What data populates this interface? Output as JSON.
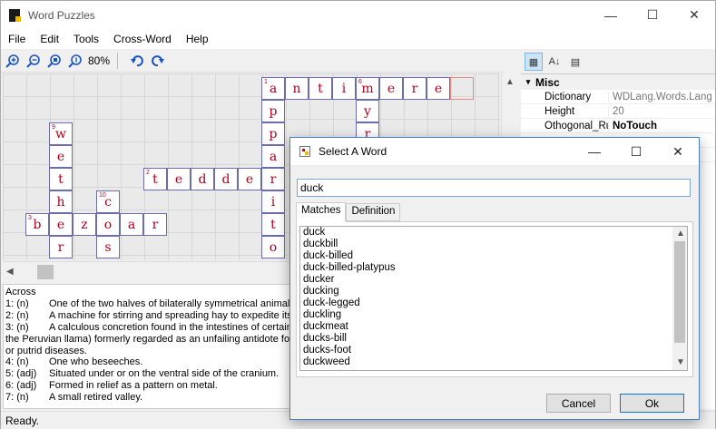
{
  "window": {
    "title": "Word Puzzles"
  },
  "menu": [
    "File",
    "Edit",
    "Tools",
    "Cross-Word",
    "Help"
  ],
  "toolbar": {
    "zoom": "80%"
  },
  "puzzle": {
    "cells": [
      {
        "row": 0,
        "col": 11,
        "letter": "a",
        "num": "1"
      },
      {
        "row": 0,
        "col": 12,
        "letter": "n"
      },
      {
        "row": 0,
        "col": 13,
        "letter": "t"
      },
      {
        "row": 0,
        "col": 14,
        "letter": "i"
      },
      {
        "row": 0,
        "col": 15,
        "letter": "m",
        "num": "6"
      },
      {
        "row": 0,
        "col": 16,
        "letter": "e"
      },
      {
        "row": 0,
        "col": 17,
        "letter": "r"
      },
      {
        "row": 0,
        "col": 18,
        "letter": "e"
      },
      {
        "row": 0,
        "col": 19,
        "letter": "",
        "empty": true
      },
      {
        "row": 1,
        "col": 11,
        "letter": "p"
      },
      {
        "row": 1,
        "col": 15,
        "letter": "y"
      },
      {
        "row": 2,
        "col": 2,
        "letter": "w",
        "num": "9"
      },
      {
        "row": 2,
        "col": 11,
        "letter": "p"
      },
      {
        "row": 2,
        "col": 15,
        "letter": "r"
      },
      {
        "row": 3,
        "col": 2,
        "letter": "e"
      },
      {
        "row": 3,
        "col": 11,
        "letter": "a"
      },
      {
        "row": 4,
        "col": 2,
        "letter": "t"
      },
      {
        "row": 4,
        "col": 6,
        "letter": "t",
        "num": "2"
      },
      {
        "row": 4,
        "col": 7,
        "letter": "e"
      },
      {
        "row": 4,
        "col": 8,
        "letter": "d"
      },
      {
        "row": 4,
        "col": 9,
        "letter": "d"
      },
      {
        "row": 4,
        "col": 10,
        "letter": "e"
      },
      {
        "row": 4,
        "col": 11,
        "letter": "r"
      },
      {
        "row": 5,
        "col": 2,
        "letter": "h"
      },
      {
        "row": 5,
        "col": 4,
        "letter": "c",
        "num": "10"
      },
      {
        "row": 5,
        "col": 11,
        "letter": "i"
      },
      {
        "row": 6,
        "col": 1,
        "letter": "b",
        "num": "3"
      },
      {
        "row": 6,
        "col": 2,
        "letter": "e"
      },
      {
        "row": 6,
        "col": 3,
        "letter": "z"
      },
      {
        "row": 6,
        "col": 4,
        "letter": "o"
      },
      {
        "row": 6,
        "col": 5,
        "letter": "a"
      },
      {
        "row": 6,
        "col": 6,
        "letter": "r"
      },
      {
        "row": 6,
        "col": 11,
        "letter": "t"
      },
      {
        "row": 7,
        "col": 2,
        "letter": "r"
      },
      {
        "row": 7,
        "col": 4,
        "letter": "s"
      },
      {
        "row": 7,
        "col": 11,
        "letter": "o"
      }
    ]
  },
  "clues": {
    "heading": "Across",
    "items": [
      {
        "no": "1: (n)",
        "text": "One of the two halves of bilaterally symmetrical animals."
      },
      {
        "no": "2: (n)",
        "text": "A machine for stirring and spreading hay to expedite its drying."
      },
      {
        "no": "3: (n)",
        "text": "A calculous concretion found in the intestines of certain ruminants (as"
      },
      {
        "no": "",
        "text": "the Peruvian llama) formerly regarded as an unfailing antidote for poisons"
      },
      {
        "no": "",
        "text": "or putrid diseases."
      },
      {
        "no": "4: (n)",
        "text": "One who beseeches."
      },
      {
        "no": "5: (adj)",
        "text": "Situated under or on the ventral side of the cranium."
      },
      {
        "no": "6: (adj)",
        "text": "Formed in relief as a pattern on metal."
      },
      {
        "no": "7: (n)",
        "text": "A small retired valley."
      }
    ]
  },
  "properties": {
    "category": "Misc",
    "rows": [
      {
        "key": "Dictionary",
        "value": "WDLang.Words.Lang",
        "style": "gray"
      },
      {
        "key": "Height",
        "value": "20",
        "style": "gray"
      },
      {
        "key": "Othogonal_Rul",
        "value": "NoTouch",
        "style": "bold"
      },
      {
        "key": "",
        "value": "",
        "style": ""
      },
      {
        "key": "",
        "value": "",
        "style": ""
      }
    ]
  },
  "status": {
    "text": "Ready."
  },
  "dialog": {
    "title": "Select A Word",
    "search_value": "duck",
    "tabs": [
      "Matches",
      "Definition"
    ],
    "matches": [
      "duck",
      "duckbill",
      "duck-billed",
      "duck-billed-platypus",
      "ducker",
      "ducking",
      "duck-legged",
      "duckling",
      "duckmeat",
      "ducks-bill",
      "ducks-foot",
      "duckweed"
    ],
    "cancel_label": "Cancel",
    "ok_label": "Ok"
  }
}
